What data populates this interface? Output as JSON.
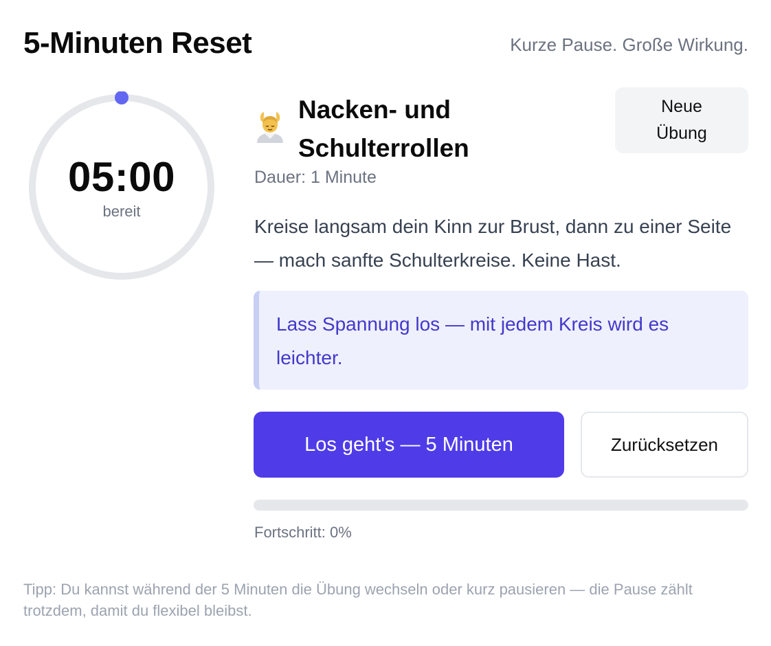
{
  "header": {
    "title": "5-Minuten Reset",
    "tagline": "Kurze Pause. Große Wirkung."
  },
  "timer": {
    "time": "05:00",
    "status": "bereit",
    "progress_fraction": 0,
    "accent_color": "#6366f1",
    "track_color": "#e5e7eb"
  },
  "exercise": {
    "icon": "person-getting-massage-emoji",
    "title": "Nacken- und Schulterrollen",
    "duration": "Dauer: 1 Minute",
    "description": "Kreise langsam dein Kinn zur Brust, dann zu einer Seite — mach sanfte Schulterkreise. Keine Hast.",
    "hint": "Lass Spannung los — mit jedem Kreis wird es leichter."
  },
  "actions": {
    "new_exercise_label": "Neue Übung",
    "start_label": "Los geht's — 5 Minuten",
    "reset_label": "Zurücksetzen"
  },
  "progress": {
    "value_percent": 0,
    "label": "Fortschritt: 0%"
  },
  "tip": "Tipp: Du kannst während der 5 Minuten die Übung wechseln oder kurz pausieren — die Pause zählt trotzdem, damit du flexibel bleibst.",
  "colors": {
    "primary": "#4f3ce8",
    "hint_background": "#eef0fd",
    "hint_text": "#4338ca",
    "muted_text": "#6b7280"
  }
}
